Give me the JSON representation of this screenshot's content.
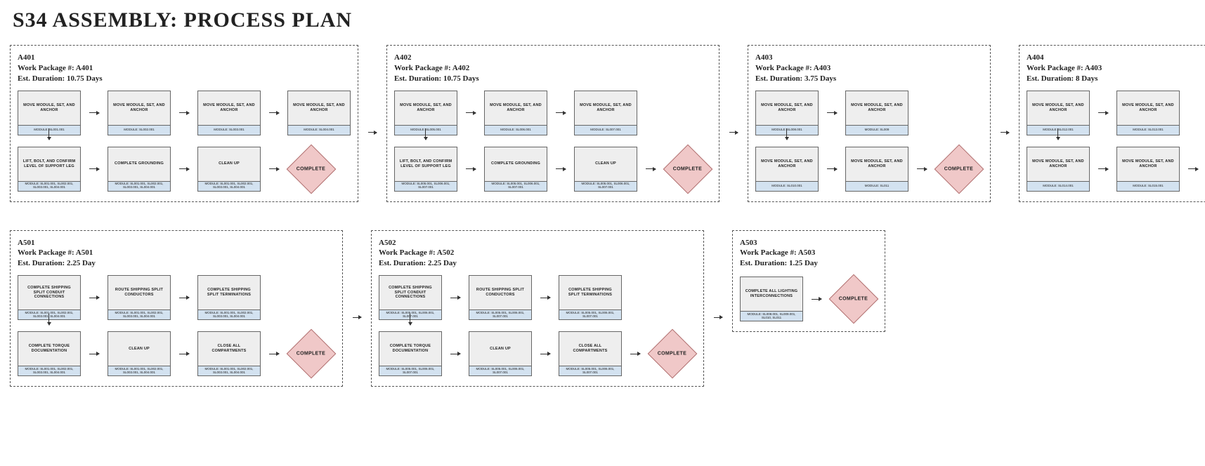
{
  "title": "S34 ASSEMBLY: PROCESS PLAN",
  "complete": "COMPLETE",
  "packages": [
    {
      "id": "A401",
      "header": "A401\nWork Package #: A401\nEst. Duration: 10.75 Days",
      "row1": [
        {
          "label": "MOVE MODULE, SET, AND ANCHOR",
          "foot": "MODULE: SL001.001"
        },
        {
          "label": "MOVE MODULE, SET, AND ANCHOR",
          "foot": "MODULE: SL002.001"
        },
        {
          "label": "MOVE MODULE, SET, AND ANCHOR",
          "foot": "MODULE: SL003.001"
        },
        {
          "label": "MOVE MODULE, SET, AND ANCHOR",
          "foot": "MODULE: SL004.001"
        }
      ],
      "row2": [
        {
          "label": "LIFT, BOLT, AND CONFIRM LEVEL OF SUPPORT LEG",
          "foot": "MODULE: SL001.001, SL002.001, SL003.001, SL004.001"
        },
        {
          "label": "COMPLETE GROUNDING",
          "foot": "MODULE: SL001.001, SL002.001, SL003.001, SL004.001"
        },
        {
          "label": "CLEAN UP",
          "foot": "MODULE: SL001.001, SL002.001, SL003.001, SL004.001"
        }
      ]
    },
    {
      "id": "A402",
      "header": "A402\nWork Package #: A402\nEst. Duration: 10.75 Days",
      "row1": [
        {
          "label": "MOVE MODULE, SET, AND ANCHOR",
          "foot": "MODULE: SL005.001"
        },
        {
          "label": "MOVE MODULE, SET, AND ANCHOR",
          "foot": "MODULE: SL006.001"
        },
        {
          "label": "MOVE MODULE, SET, AND ANCHOR",
          "foot": "MODULE: SL007.001"
        }
      ],
      "row2": [
        {
          "label": "LIFT, BOLT, AND CONFIRM LEVEL OF SUPPORT LEG",
          "foot": "MODULE: SL005.001, SL006.001, SL007.001"
        },
        {
          "label": "COMPLETE GROUNDING",
          "foot": "MODULE: SL005.001, SL006.001, SL007.001"
        },
        {
          "label": "CLEAN UP",
          "foot": "MODULE: SL005.001, SL006.001, SL007.001"
        }
      ]
    },
    {
      "id": "A403",
      "header": "A403\nWork Package #: A403\nEst. Duration: 3.75 Days",
      "row1": [
        {
          "label": "MOVE MODULE, SET, AND ANCHOR",
          "foot": "MODULE: SL008.001"
        },
        {
          "label": "MOVE MODULE, SET, AND ANCHOR",
          "foot": "MODULE: SL009"
        }
      ],
      "row2": [
        {
          "label": "MOVE MODULE, SET, AND ANCHOR",
          "foot": "MODULE: SL010.001"
        },
        {
          "label": "MOVE MODULE, SET, AND ANCHOR",
          "foot": "MODULE: SL011"
        }
      ]
    },
    {
      "id": "A404",
      "header": "A404\nWork Package #: A403\nEst. Duration: 8 Days",
      "row1": [
        {
          "label": "MOVE MODULE, SET, AND ANCHOR",
          "foot": "MODULE: SL012.001"
        },
        {
          "label": "MOVE MODULE, SET, AND ANCHOR",
          "foot": "MODULE: SL013.001"
        }
      ],
      "row2": [
        {
          "label": "MOVE MODULE, SET, AND ANCHOR",
          "foot": "MODULE: SL014.001"
        },
        {
          "label": "MOVE MODULE, SET, AND ANCHOR",
          "foot": "MODULE: SL015.001"
        }
      ]
    },
    {
      "id": "A501",
      "header": "A501\nWork Package #: A501\nEst. Duration: 2.25 Day",
      "row1": [
        {
          "label": "COMPLETE SHIPPING SPLIT CONDUIT CONNECTIONS",
          "foot": "MODULE: SL001.001, SL002.001, SL003.001, SL004.001"
        },
        {
          "label": "ROUTE SHIPPING SPLIT CONDUCTORS",
          "foot": "MODULE: SL001.001, SL002.001, SL003.001, SL004.001"
        },
        {
          "label": "COMPLETE SHIPPING SPLIT TERMINATIONS",
          "foot": "MODULE: SL001.001, SL002.001, SL003.001, SL004.001"
        }
      ],
      "row2": [
        {
          "label": "COMPLETE TORQUE DOCUMENTATION",
          "foot": "MODULE: SL001.001, SL002.001, SL003.001, SL004.001"
        },
        {
          "label": "CLEAN UP",
          "foot": "MODULE: SL001.001, SL002.001, SL003.001, SL004.001"
        },
        {
          "label": "CLOSE ALL COMPARTMENTS",
          "foot": "MODULE: SL001.001, SL002.001, SL003.001, SL004.001"
        }
      ]
    },
    {
      "id": "A502",
      "header": "A502\nWork Package #: A502\nEst. Duration: 2.25 Day",
      "row1": [
        {
          "label": "COMPLETE SHIPPING SPLIT CONDUIT CONNECTIONS",
          "foot": "MODULE: SL005.001, SL006.001, SL007.001"
        },
        {
          "label": "ROUTE SHIPPING SPLIT CONDUCTORS",
          "foot": "MODULE: SL005.001, SL006.001, SL007.001"
        },
        {
          "label": "COMPLETE SHIPPING SPLIT TERMINATIONS",
          "foot": "MODULE: SL005.001, SL006.001, SL007.001"
        }
      ],
      "row2": [
        {
          "label": "COMPLETE TORQUE DOCUMENTATION",
          "foot": "MODULE: SL005.001, SL006.001, SL007.001"
        },
        {
          "label": "CLEAN UP",
          "foot": "MODULE: SL005.001, SL006.001, SL007.001"
        },
        {
          "label": "CLOSE ALL COMPARTMENTS",
          "foot": "MODULE: SL005.001, SL006.001, SL007.001"
        }
      ]
    },
    {
      "id": "A503",
      "header": "A503\nWork Package #: A503\nEst. Duration: 1.25 Day",
      "row1": [
        {
          "label": "COMPLETE ALL LIGHTING INTERCONNECTIONS",
          "foot": "MODULE: SL008.001, SL009.001, SL010, SL011"
        }
      ],
      "row2": []
    }
  ]
}
